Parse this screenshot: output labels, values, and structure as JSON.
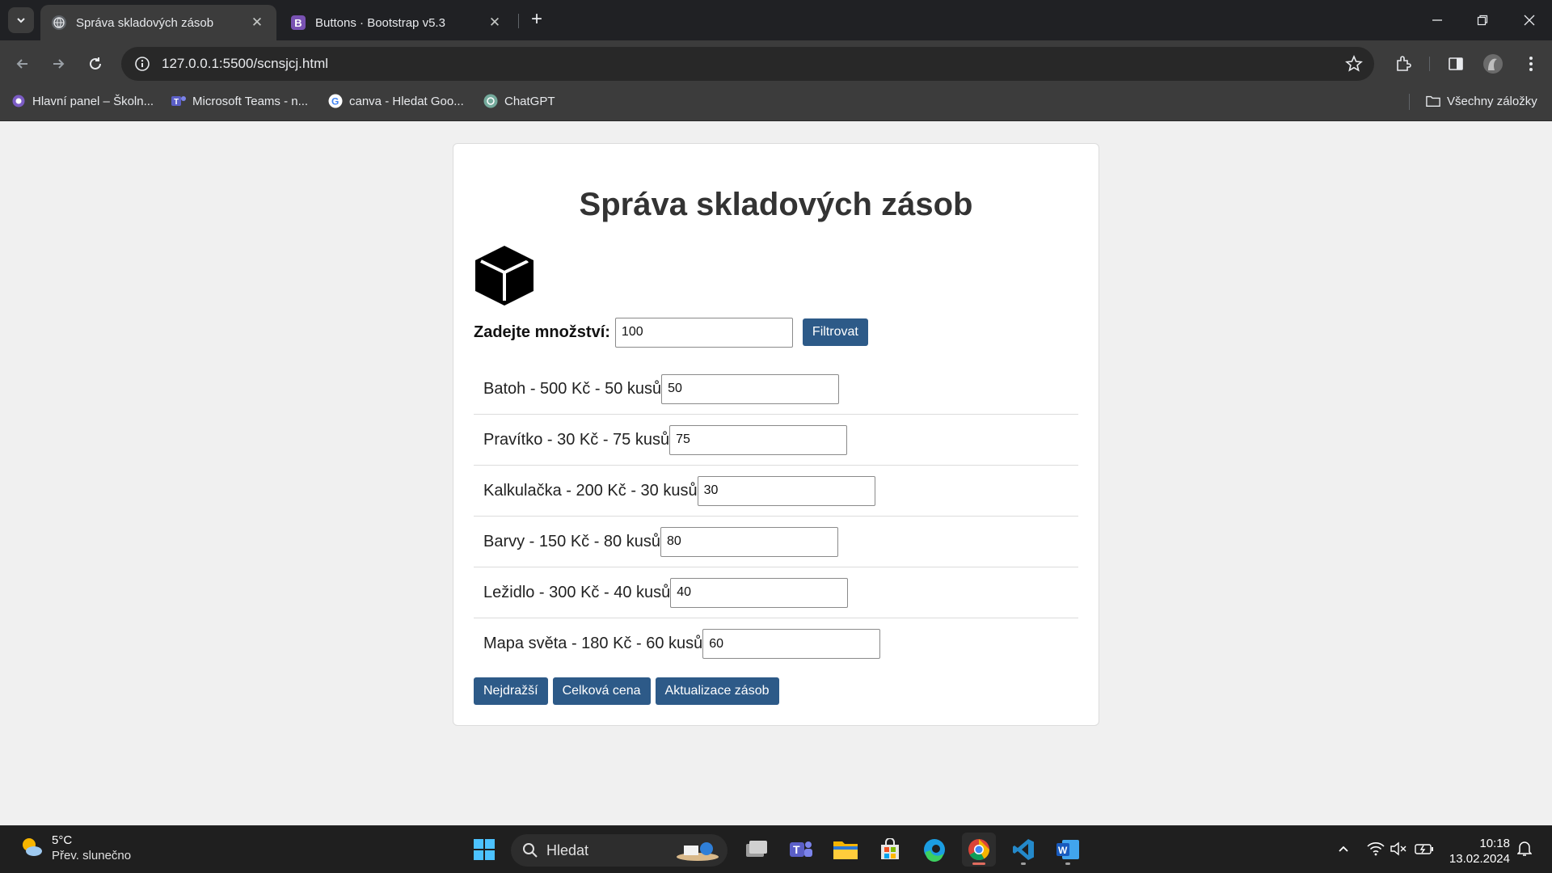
{
  "browser": {
    "tabs": [
      {
        "title": "Správa skladových zásob",
        "active": true
      },
      {
        "title": "Buttons · Bootstrap v5.3",
        "active": false
      }
    ],
    "url": "127.0.0.1:5500/scnsjcj.html",
    "bookmarks": [
      {
        "label": "Hlavní panel – Školn..."
      },
      {
        "label": "Microsoft Teams - n..."
      },
      {
        "label": "canva - Hledat Goo..."
      },
      {
        "label": "ChatGPT"
      }
    ],
    "all_bookmarks": "Všechny záložky"
  },
  "page": {
    "title": "Správa skladových zásob",
    "filter": {
      "label": "Zadejte množství:",
      "value": "100",
      "button": "Filtrovat"
    },
    "items": [
      {
        "text": "Batoh - 500 Kč - 50 kusů",
        "qty": "50"
      },
      {
        "text": "Pravítko - 30 Kč - 75 kusů",
        "qty": "75"
      },
      {
        "text": "Kalkulačka - 200 Kč - 30 kusů",
        "qty": "30"
      },
      {
        "text": "Barvy - 150 Kč - 80 kusů",
        "qty": "80"
      },
      {
        "text": "Ležidlo - 300 Kč - 40 kusů",
        "qty": "40"
      },
      {
        "text": "Mapa světa - 180 Kč - 60 kusů",
        "qty": "60"
      }
    ],
    "actions": {
      "most_expensive": "Nejdražší",
      "total_price": "Celková cena",
      "update_stock": "Aktualizace zásob"
    }
  },
  "taskbar": {
    "weather": {
      "temp": "5°C",
      "desc": "Přev. slunečno"
    },
    "search": "Hledat",
    "time": "10:18",
    "date": "13.02.2024"
  },
  "colors": {
    "button_bg": "#2d5a88",
    "heading": "#333333",
    "page_bg": "#f0f0f0"
  }
}
